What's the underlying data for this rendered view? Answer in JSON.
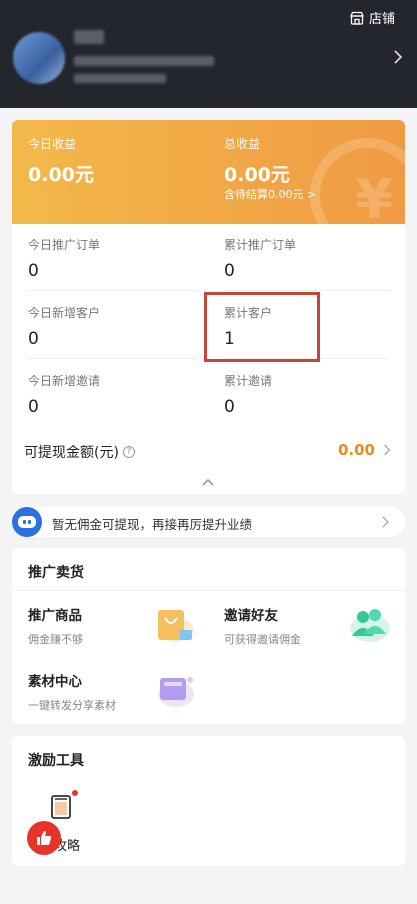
{
  "header": {
    "store_label": "店铺",
    "colors": {
      "bg": "#23262d"
    }
  },
  "earnings": {
    "today_label": "今日收益",
    "today_value": "0.00元",
    "total_label": "总收益",
    "total_value": "0.00元",
    "pending_text": "含待结算0.00元 >"
  },
  "stats": [
    {
      "label": "今日推广订单",
      "value": "0"
    },
    {
      "label": "累计推广订单",
      "value": "0"
    },
    {
      "label": "今日新增客户",
      "value": "0"
    },
    {
      "label": "累计客户",
      "value": "1"
    },
    {
      "label": "今日新增邀请",
      "value": "0"
    },
    {
      "label": "累计邀请",
      "value": "0"
    }
  ],
  "withdraw": {
    "label": "可提现金额(元)",
    "help_glyph": "?",
    "value": "0.00"
  },
  "tip": {
    "text": "暂无佣金可提现，再接再厉提升业绩"
  },
  "promo": {
    "title": "推广卖货",
    "items": [
      {
        "title": "推广商品",
        "sub": "佣金赚不够",
        "icon": "shopping-bag-icon"
      },
      {
        "title": "邀请好友",
        "sub": "可获得邀请佣金",
        "icon": "friends-icon"
      },
      {
        "title": "素材中心",
        "sub": "一键转发分享素材",
        "icon": "material-icon"
      }
    ]
  },
  "incentive": {
    "title": "激励工具",
    "item_label": "攻略"
  },
  "colors": {
    "accent_orange": "#f08a18",
    "card_gradient_start": "#f3b94a",
    "card_gradient_end": "#f09a43",
    "highlight_box": "#c9453a",
    "float_red": "#e8332a"
  }
}
